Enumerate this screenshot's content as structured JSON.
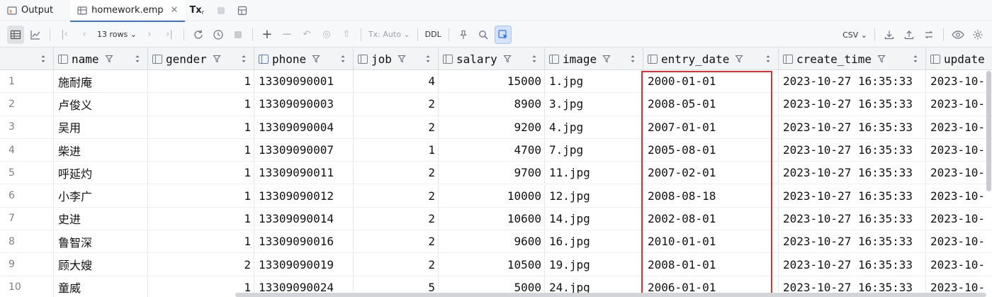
{
  "tabs": [
    {
      "label": "Output",
      "icon": "output-icon",
      "active": false
    },
    {
      "label": "homework.emp",
      "icon": "table-icon",
      "active": true
    },
    {
      "label": "Tx",
      "icon": "tx-mode-icon",
      "active": false
    }
  ],
  "toolbar": {
    "rows_label": "13 rows",
    "tx_label": "Tx: Auto",
    "ddl_label": "DDL",
    "export_format": "CSV"
  },
  "columns": [
    {
      "name": "",
      "type": "rownum-select"
    },
    {
      "name": "name"
    },
    {
      "name": "gender"
    },
    {
      "name": "phone",
      "key": true
    },
    {
      "name": "job"
    },
    {
      "name": "salary"
    },
    {
      "name": "image"
    },
    {
      "name": "entry_date"
    },
    {
      "name": "create_time"
    },
    {
      "name": "update"
    }
  ],
  "rows": [
    {
      "n": "1",
      "name": "施耐庵",
      "gender": "1",
      "phone": "13309090001",
      "job": "4",
      "salary": "15000",
      "image": "1.jpg",
      "entry_date": "2000-01-01",
      "create_time": "2023-10-27 16:35:33",
      "update": "2023-10-"
    },
    {
      "n": "2",
      "name": "卢俊义",
      "gender": "1",
      "phone": "13309090003",
      "job": "2",
      "salary": "8900",
      "image": "3.jpg",
      "entry_date": "2008-05-01",
      "create_time": "2023-10-27 16:35:33",
      "update": "2023-10-"
    },
    {
      "n": "3",
      "name": "吴用",
      "gender": "1",
      "phone": "13309090004",
      "job": "2",
      "salary": "9200",
      "image": "4.jpg",
      "entry_date": "2007-01-01",
      "create_time": "2023-10-27 16:35:33",
      "update": "2023-10-"
    },
    {
      "n": "4",
      "name": "柴进",
      "gender": "1",
      "phone": "13309090007",
      "job": "1",
      "salary": "4700",
      "image": "7.jpg",
      "entry_date": "2005-08-01",
      "create_time": "2023-10-27 16:35:33",
      "update": "2023-10-"
    },
    {
      "n": "5",
      "name": "呼延灼",
      "gender": "1",
      "phone": "13309090011",
      "job": "2",
      "salary": "9700",
      "image": "11.jpg",
      "entry_date": "2007-02-01",
      "create_time": "2023-10-27 16:35:33",
      "update": "2023-10-"
    },
    {
      "n": "6",
      "name": "小李广",
      "gender": "1",
      "phone": "13309090012",
      "job": "2",
      "salary": "10000",
      "image": "12.jpg",
      "entry_date": "2008-08-18",
      "create_time": "2023-10-27 16:35:33",
      "update": "2023-10-"
    },
    {
      "n": "7",
      "name": "史进",
      "gender": "1",
      "phone": "13309090014",
      "job": "2",
      "salary": "10600",
      "image": "14.jpg",
      "entry_date": "2002-08-01",
      "create_time": "2023-10-27 16:35:33",
      "update": "2023-10-"
    },
    {
      "n": "8",
      "name": "鲁智深",
      "gender": "1",
      "phone": "13309090016",
      "job": "2",
      "salary": "9600",
      "image": "16.jpg",
      "entry_date": "2010-01-01",
      "create_time": "2023-10-27 16:35:33",
      "update": "2023-10-"
    },
    {
      "n": "9",
      "name": "顾大嫂",
      "gender": "2",
      "phone": "13309090019",
      "job": "2",
      "salary": "10500",
      "image": "19.jpg",
      "entry_date": "2008-01-01",
      "create_time": "2023-10-27 16:35:33",
      "update": "2023-10-"
    },
    {
      "n": "10",
      "name": "童威",
      "gender": "1",
      "phone": "13309090024",
      "job": "5",
      "salary": "5000",
      "image": "24.jpg",
      "entry_date": "2006-01-01",
      "create_time": "2023-10-27 16:35:33",
      "update": "2023-10-"
    }
  ],
  "colors": {
    "accent": "#3574f0",
    "highlight_box": "#e02f2f"
  }
}
